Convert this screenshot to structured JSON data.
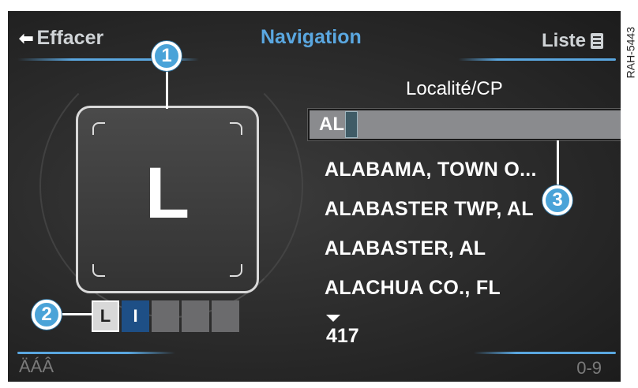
{
  "header": {
    "back_label": "Effacer",
    "title": "Navigation",
    "list_label": "Liste"
  },
  "side_code": "RAH-5443",
  "entry": {
    "field_title": "Localité/CP",
    "input_value": "AL"
  },
  "speller": {
    "current_letter": "L",
    "slots": [
      "L",
      "I",
      "",
      "",
      ""
    ]
  },
  "results": [
    "ALABAMA, TOWN O...",
    "ALABASTER TWP, AL",
    "ALABASTER, AL",
    "ALACHUA CO., FL"
  ],
  "result_count": "417",
  "footer": {
    "left_label": "ÄÁÂ",
    "right_label": "0-9"
  },
  "callouts": [
    "1",
    "2",
    "3"
  ],
  "colors": {
    "accent": "#5aa7e0",
    "screen_bg": "#2a2a2a",
    "callout": "#4aa3d8"
  }
}
